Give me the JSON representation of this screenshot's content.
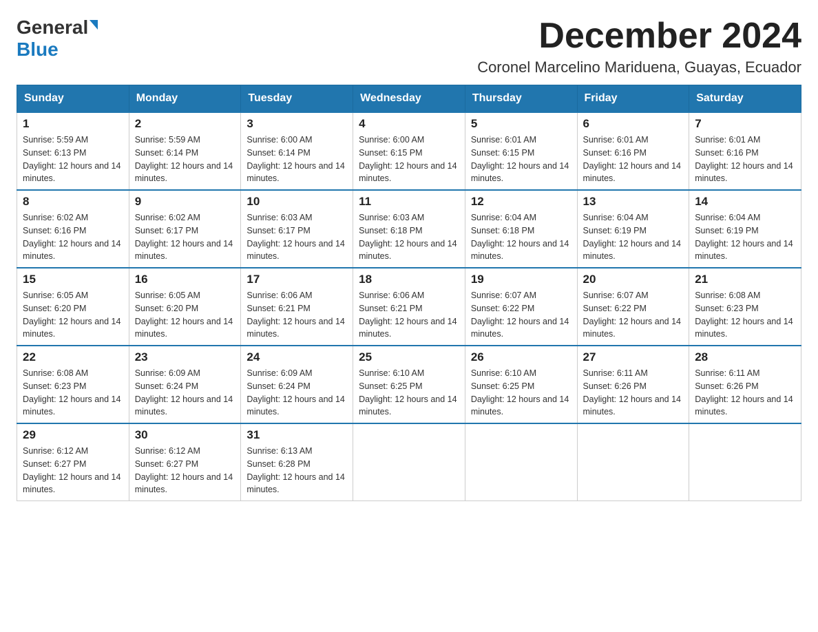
{
  "header": {
    "logo_general": "General",
    "logo_blue": "Blue",
    "month_year": "December 2024",
    "location": "Coronel Marcelino Mariduena, Guayas, Ecuador"
  },
  "days_of_week": [
    "Sunday",
    "Monday",
    "Tuesday",
    "Wednesday",
    "Thursday",
    "Friday",
    "Saturday"
  ],
  "weeks": [
    [
      {
        "day": "1",
        "sunrise": "5:59 AM",
        "sunset": "6:13 PM",
        "daylight": "12 hours and 14 minutes."
      },
      {
        "day": "2",
        "sunrise": "5:59 AM",
        "sunset": "6:14 PM",
        "daylight": "12 hours and 14 minutes."
      },
      {
        "day": "3",
        "sunrise": "6:00 AM",
        "sunset": "6:14 PM",
        "daylight": "12 hours and 14 minutes."
      },
      {
        "day": "4",
        "sunrise": "6:00 AM",
        "sunset": "6:15 PM",
        "daylight": "12 hours and 14 minutes."
      },
      {
        "day": "5",
        "sunrise": "6:01 AM",
        "sunset": "6:15 PM",
        "daylight": "12 hours and 14 minutes."
      },
      {
        "day": "6",
        "sunrise": "6:01 AM",
        "sunset": "6:16 PM",
        "daylight": "12 hours and 14 minutes."
      },
      {
        "day": "7",
        "sunrise": "6:01 AM",
        "sunset": "6:16 PM",
        "daylight": "12 hours and 14 minutes."
      }
    ],
    [
      {
        "day": "8",
        "sunrise": "6:02 AM",
        "sunset": "6:16 PM",
        "daylight": "12 hours and 14 minutes."
      },
      {
        "day": "9",
        "sunrise": "6:02 AM",
        "sunset": "6:17 PM",
        "daylight": "12 hours and 14 minutes."
      },
      {
        "day": "10",
        "sunrise": "6:03 AM",
        "sunset": "6:17 PM",
        "daylight": "12 hours and 14 minutes."
      },
      {
        "day": "11",
        "sunrise": "6:03 AM",
        "sunset": "6:18 PM",
        "daylight": "12 hours and 14 minutes."
      },
      {
        "day": "12",
        "sunrise": "6:04 AM",
        "sunset": "6:18 PM",
        "daylight": "12 hours and 14 minutes."
      },
      {
        "day": "13",
        "sunrise": "6:04 AM",
        "sunset": "6:19 PM",
        "daylight": "12 hours and 14 minutes."
      },
      {
        "day": "14",
        "sunrise": "6:04 AM",
        "sunset": "6:19 PM",
        "daylight": "12 hours and 14 minutes."
      }
    ],
    [
      {
        "day": "15",
        "sunrise": "6:05 AM",
        "sunset": "6:20 PM",
        "daylight": "12 hours and 14 minutes."
      },
      {
        "day": "16",
        "sunrise": "6:05 AM",
        "sunset": "6:20 PM",
        "daylight": "12 hours and 14 minutes."
      },
      {
        "day": "17",
        "sunrise": "6:06 AM",
        "sunset": "6:21 PM",
        "daylight": "12 hours and 14 minutes."
      },
      {
        "day": "18",
        "sunrise": "6:06 AM",
        "sunset": "6:21 PM",
        "daylight": "12 hours and 14 minutes."
      },
      {
        "day": "19",
        "sunrise": "6:07 AM",
        "sunset": "6:22 PM",
        "daylight": "12 hours and 14 minutes."
      },
      {
        "day": "20",
        "sunrise": "6:07 AM",
        "sunset": "6:22 PM",
        "daylight": "12 hours and 14 minutes."
      },
      {
        "day": "21",
        "sunrise": "6:08 AM",
        "sunset": "6:23 PM",
        "daylight": "12 hours and 14 minutes."
      }
    ],
    [
      {
        "day": "22",
        "sunrise": "6:08 AM",
        "sunset": "6:23 PM",
        "daylight": "12 hours and 14 minutes."
      },
      {
        "day": "23",
        "sunrise": "6:09 AM",
        "sunset": "6:24 PM",
        "daylight": "12 hours and 14 minutes."
      },
      {
        "day": "24",
        "sunrise": "6:09 AM",
        "sunset": "6:24 PM",
        "daylight": "12 hours and 14 minutes."
      },
      {
        "day": "25",
        "sunrise": "6:10 AM",
        "sunset": "6:25 PM",
        "daylight": "12 hours and 14 minutes."
      },
      {
        "day": "26",
        "sunrise": "6:10 AM",
        "sunset": "6:25 PM",
        "daylight": "12 hours and 14 minutes."
      },
      {
        "day": "27",
        "sunrise": "6:11 AM",
        "sunset": "6:26 PM",
        "daylight": "12 hours and 14 minutes."
      },
      {
        "day": "28",
        "sunrise": "6:11 AM",
        "sunset": "6:26 PM",
        "daylight": "12 hours and 14 minutes."
      }
    ],
    [
      {
        "day": "29",
        "sunrise": "6:12 AM",
        "sunset": "6:27 PM",
        "daylight": "12 hours and 14 minutes."
      },
      {
        "day": "30",
        "sunrise": "6:12 AM",
        "sunset": "6:27 PM",
        "daylight": "12 hours and 14 minutes."
      },
      {
        "day": "31",
        "sunrise": "6:13 AM",
        "sunset": "6:28 PM",
        "daylight": "12 hours and 14 minutes."
      },
      null,
      null,
      null,
      null
    ]
  ]
}
